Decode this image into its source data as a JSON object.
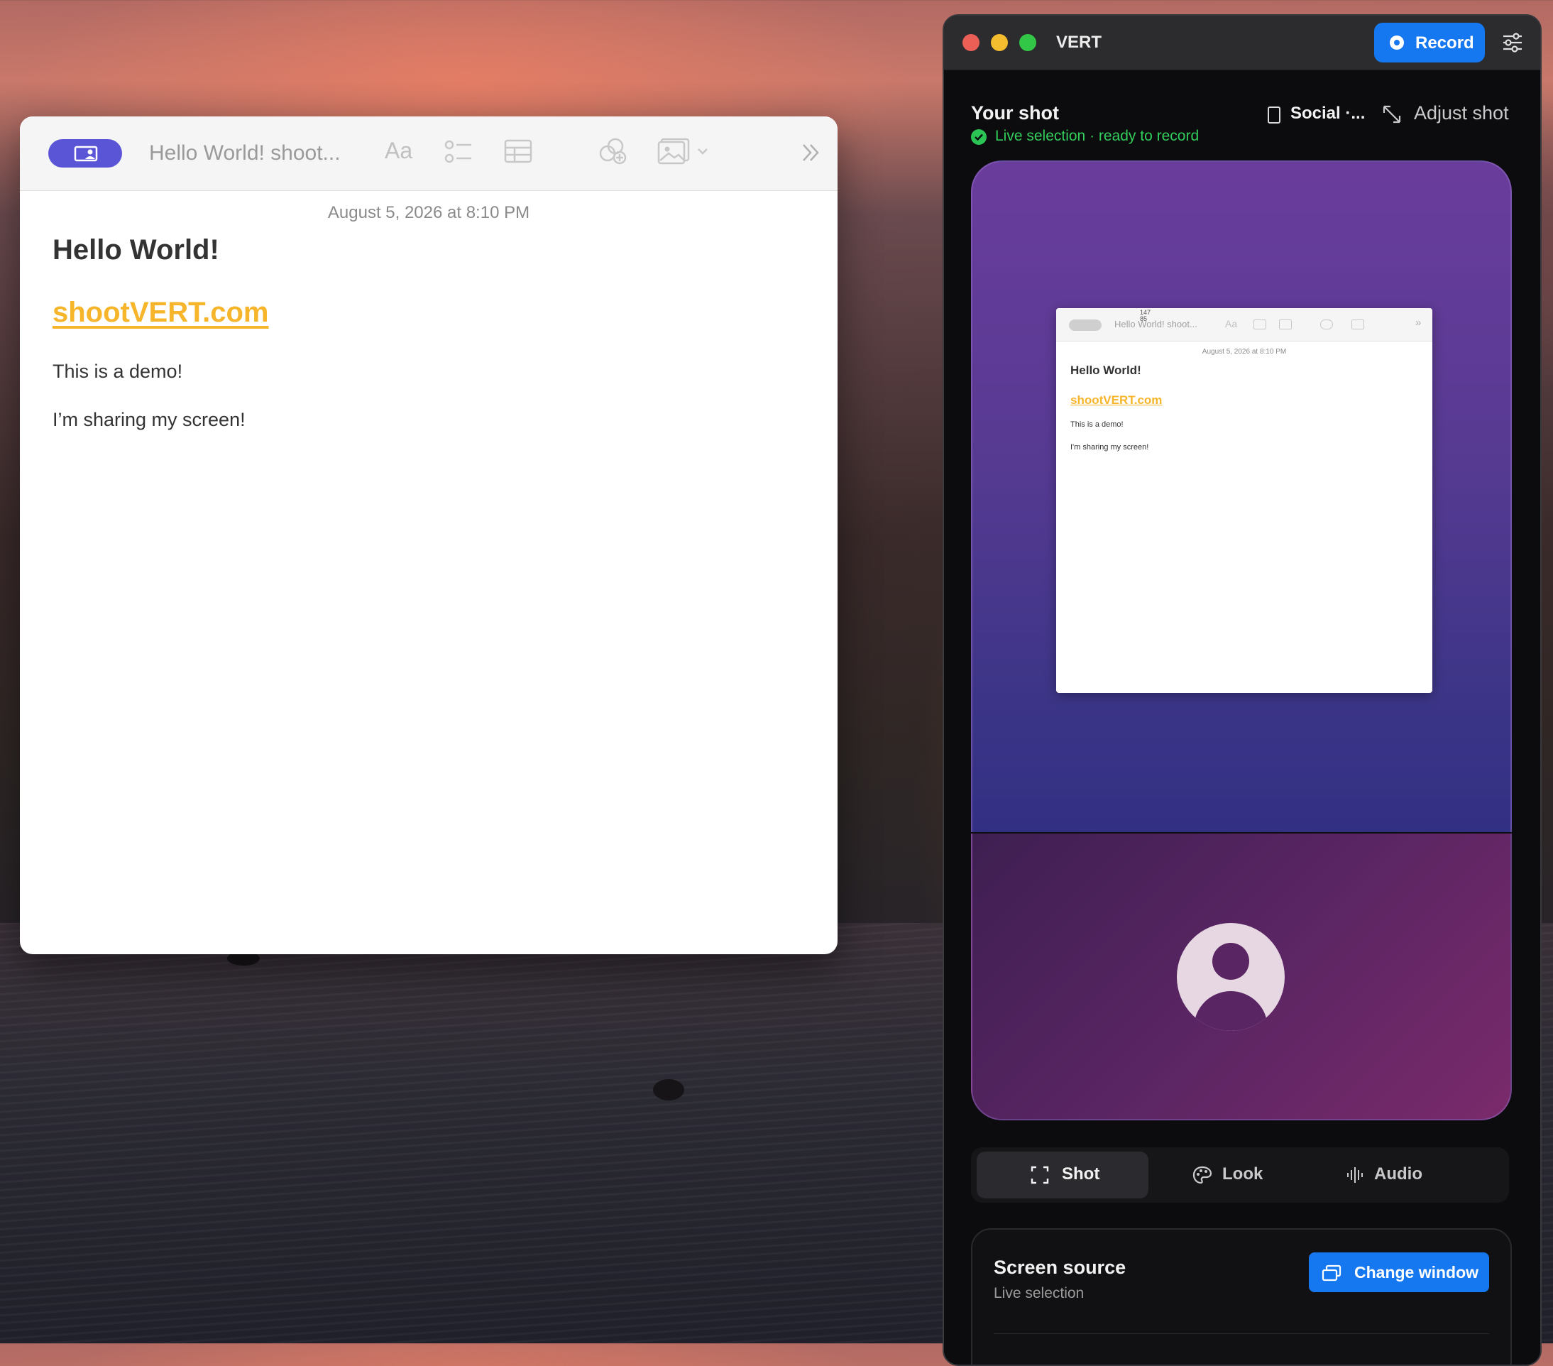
{
  "notes": {
    "toolbar_title": "Hello World! shoot...",
    "font_button": "Aa",
    "date": "August 5, 2026 at 8:10 PM",
    "heading": "Hello World!",
    "link": "shootVERT.com",
    "paragraph1": "This is a demo!",
    "paragraph2": "I’m sharing my screen!"
  },
  "vert": {
    "app_name": "VERT",
    "record_label": "Record",
    "shot_title": "Your shot",
    "status_text": "Live selection · ready to record",
    "format_label": "Social ·...",
    "adjust_label": "Adjust shot",
    "preview": {
      "toolbar_title": "Hello World! shoot...",
      "font_button": "Aa",
      "cursor_coords": "147\n85",
      "date": "August 5, 2026 at 8:10 PM",
      "heading": "Hello World!",
      "link": "shootVERT.com",
      "paragraph1": "This is a demo!",
      "paragraph2": "I'm sharing my screen!"
    },
    "tabs": [
      {
        "label": "Shot",
        "icon": "frame-icon",
        "active": true
      },
      {
        "label": "Look",
        "icon": "palette-icon",
        "active": false
      },
      {
        "label": "Audio",
        "icon": "waveform-icon",
        "active": false
      }
    ],
    "source": {
      "title": "Screen source",
      "subtitle": "Live selection",
      "button_label": "Change window"
    }
  },
  "colors": {
    "accent_blue": "#1678f1",
    "live_green": "#33cd5b",
    "link_yellow": "#f6b52a",
    "notes_share": "#5a55d6"
  }
}
